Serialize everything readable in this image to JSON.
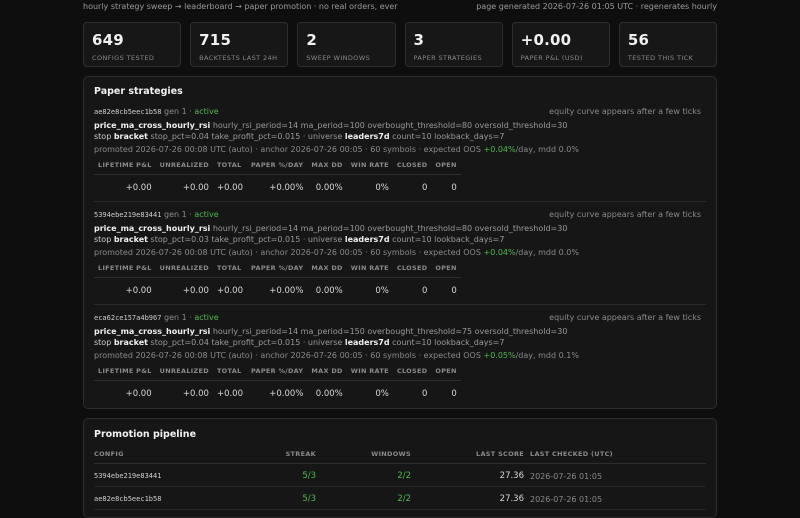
{
  "topbar": {
    "left": "hourly strategy sweep → leaderboard → paper promotion · no real orders, ever",
    "right": "page generated 2026-07-26 01:05 UTC · regenerates hourly"
  },
  "stats": [
    {
      "value": "649",
      "label": "CONFIGS TESTED"
    },
    {
      "value": "715",
      "label": "BACKTESTS LAST 24H"
    },
    {
      "value": "2",
      "label": "SWEEP WINDOWS"
    },
    {
      "value": "3",
      "label": "PAPER STRATEGIES"
    },
    {
      "value": "+0.00",
      "label": "PAPER P&L (USD)"
    },
    {
      "value": "56",
      "label": "TESTED THIS TICK"
    }
  ],
  "paper": {
    "title": "Paper strategies",
    "metric_headers": [
      "LIFETIME P&L",
      "UNREALIZED",
      "TOTAL",
      "PAPER %/DAY",
      "MAX DD",
      "WIN RATE",
      "CLOSED",
      "OPEN"
    ],
    "strategies": [
      {
        "hash": "ae82e8cb5eec1b58",
        "gen": "gen 1",
        "dot": "·",
        "status": "active",
        "equity_note": "equity curve appears after a few ticks",
        "entry_name": "price_ma_cross_hourly_rsi",
        "entry_params": "hourly_rsi_period=14 ma_period=100 overbought_threshold=80 oversold_threshold=30",
        "stop_label": "stop",
        "stop_name": "bracket",
        "stop_params": "stop_pct=0.04 take_profit_pct=0.015 · universe",
        "universe_name": "leaders7d",
        "universe_params": "count=10 lookback_days=7",
        "promoted_pre": "promoted 2026-07-26 00:08 UTC (auto) · anchor 2026-07-26 00:05 · 60 symbols · expected OOS",
        "oos": "+0.04%",
        "promoted_post": "/day, mdd 0.0%",
        "metrics": [
          "+0.00",
          "+0.00",
          "+0.00",
          "+0.00%",
          "0.00%",
          "0%",
          "0",
          "0"
        ]
      },
      {
        "hash": "5394ebe219e83441",
        "gen": "gen 1",
        "dot": "·",
        "status": "active",
        "equity_note": "equity curve appears after a few ticks",
        "entry_name": "price_ma_cross_hourly_rsi",
        "entry_params": "hourly_rsi_period=14 ma_period=100 overbought_threshold=80 oversold_threshold=30",
        "stop_label": "stop",
        "stop_name": "bracket",
        "stop_params": "stop_pct=0.03 take_profit_pct=0.015 · universe",
        "universe_name": "leaders7d",
        "universe_params": "count=10 lookback_days=7",
        "promoted_pre": "promoted 2026-07-26 00:08 UTC (auto) · anchor 2026-07-26 00:05 · 60 symbols · expected OOS",
        "oos": "+0.04%",
        "promoted_post": "/day, mdd 0.0%",
        "metrics": [
          "+0.00",
          "+0.00",
          "+0.00",
          "+0.00%",
          "0.00%",
          "0%",
          "0",
          "0"
        ]
      },
      {
        "hash": "eca62ce157a4b967",
        "gen": "gen 1",
        "dot": "·",
        "status": "active",
        "equity_note": "equity curve appears after a few ticks",
        "entry_name": "price_ma_cross_hourly_rsi",
        "entry_params": "hourly_rsi_period=14 ma_period=150 overbought_threshold=75 oversold_threshold=30",
        "stop_label": "stop",
        "stop_name": "bracket",
        "stop_params": "stop_pct=0.04 take_profit_pct=0.015 · universe",
        "universe_name": "leaders7d",
        "universe_params": "count=10 lookback_days=7",
        "promoted_pre": "promoted 2026-07-26 00:08 UTC (auto) · anchor 2026-07-26 00:05 · 60 symbols · expected OOS",
        "oos": "+0.05%",
        "promoted_post": "/day, mdd 0.1%",
        "metrics": [
          "+0.00",
          "+0.00",
          "+0.00",
          "+0.00%",
          "0.00%",
          "0%",
          "0",
          "0"
        ]
      }
    ]
  },
  "promotion": {
    "title": "Promotion pipeline",
    "headers": [
      "CONFIG",
      "STREAK",
      "WINDOWS",
      "LAST SCORE",
      "LAST CHECKED (UTC)"
    ],
    "rows": [
      {
        "config": "5394ebe219e83441",
        "streak": "5/3",
        "windows": "2/2",
        "score": "27.36",
        "checked": "2026-07-26 01:05"
      },
      {
        "config": "ae82e8cb5eec1b58",
        "streak": "5/3",
        "windows": "2/2",
        "score": "27.36",
        "checked": "2026-07-26 01:05"
      }
    ]
  },
  "colors": {
    "background": "#0e0e0e",
    "panel": "#161616",
    "positive": "#4fb84f",
    "border": "#2c2c2c"
  }
}
